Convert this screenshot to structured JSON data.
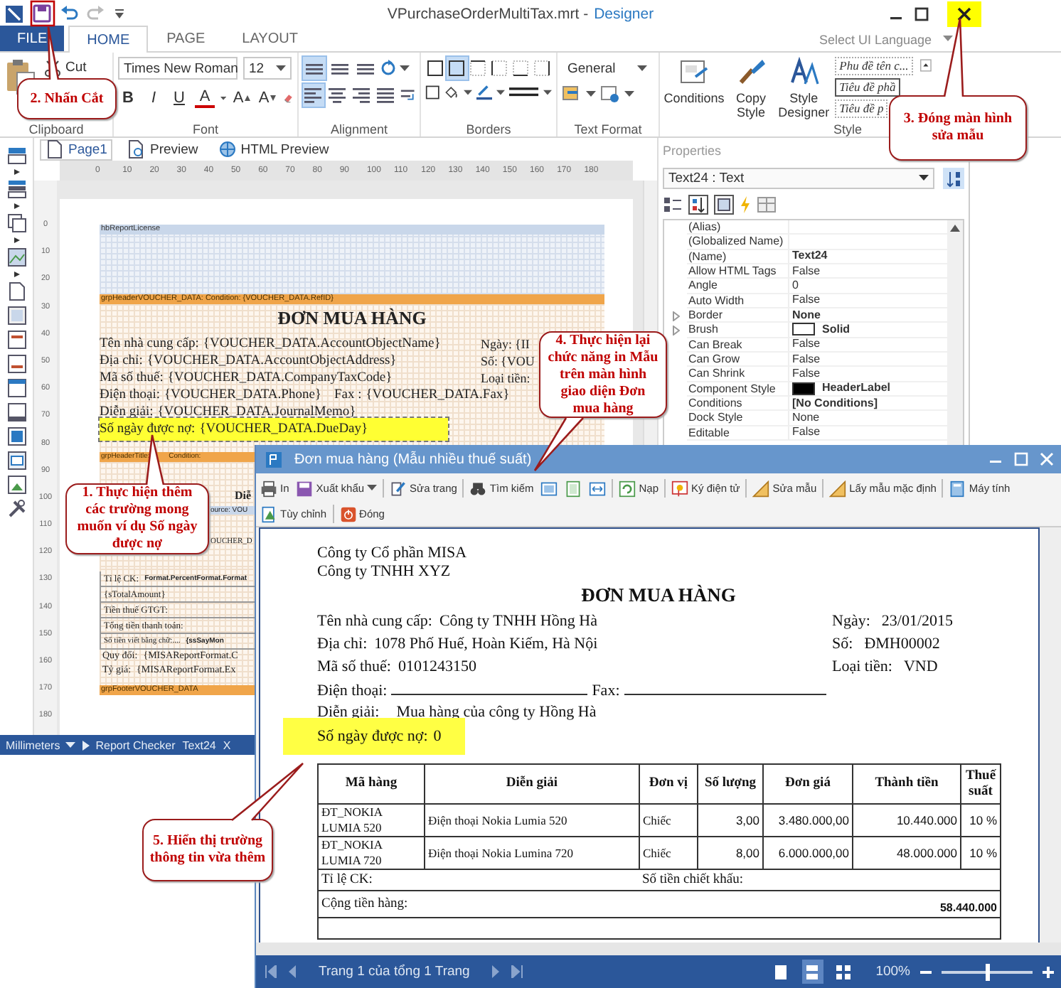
{
  "designer": {
    "title": "VPurchaseOrderMultiTax.mrt -",
    "app_name": "Designer",
    "close_button": {
      "highlighted": true
    },
    "ribbon_tabs": [
      {
        "label": "FILE",
        "kind": "file",
        "selected": false
      },
      {
        "label": "HOME",
        "kind": "tab",
        "selected": true
      },
      {
        "label": "PAGE",
        "kind": "tab",
        "selected": false
      },
      {
        "label": "LAYOUT",
        "kind": "tab",
        "selected": false
      }
    ],
    "ui_language": "Select UI Language",
    "ribbon": {
      "cut": "Cut",
      "font_name": "Times New Roman",
      "font_size": "12",
      "font_buttons": [
        {
          "label": "B",
          "kind": "bold"
        },
        {
          "label": "I",
          "kind": "italic"
        },
        {
          "label": "U",
          "kind": "underline"
        },
        {
          "label": "A",
          "kind": "color"
        },
        {
          "label": "A",
          "kind": "grow"
        },
        {
          "label": "A",
          "kind": "shrink"
        }
      ],
      "alignment": [
        {
          "selected": true
        },
        {
          "selected": false
        },
        {
          "selected": false
        },
        {
          "selected": true
        },
        {
          "selected": false
        },
        {
          "selected": false
        },
        {
          "selected": false
        }
      ],
      "borders": [
        {
          "selected": false
        },
        {
          "selected": true
        },
        {
          "selected": false
        },
        {
          "selected": false
        },
        {
          "selected": false
        },
        {
          "selected": false
        }
      ],
      "text_format": "General",
      "style_buttons": [
        "Conditions",
        "Copy Style",
        "Style Designer"
      ],
      "styles": [
        {
          "label": "Phu đề tên c...",
          "selected": false
        },
        {
          "label": "Tiêu đề phầ",
          "selected": true
        },
        {
          "label": "Tiêu đề p",
          "selected": false
        }
      ],
      "groups": [
        "Clipboard",
        "Font",
        "Alignment",
        "Borders",
        "Text Format",
        "Style"
      ]
    },
    "page_tabs": [
      {
        "label": "Page1",
        "selected": true
      },
      {
        "label": "Preview",
        "selected": false
      },
      {
        "label": "HTML Preview",
        "selected": false
      }
    ],
    "h_ruler": [
      "0",
      "10",
      "20",
      "30",
      "40",
      "50",
      "60",
      "70",
      "80",
      "90",
      "100",
      "110",
      "120",
      "130",
      "140",
      "150",
      "160",
      "170",
      "180"
    ],
    "v_ruler": [
      "0",
      "10",
      "20",
      "30",
      "40",
      "50",
      "60",
      "70",
      "80",
      "90",
      "100",
      "110",
      "120",
      "130",
      "140",
      "150",
      "160",
      "170",
      "180"
    ],
    "report": {
      "license_band": "hbReportLicense",
      "group_header": "grpHeaderVOUCHER_DATA: Condition: {VOUCHER_DATA.RefID}",
      "title": "ĐƠN MUA HÀNG",
      "fields": [
        {
          "label": "Tên nhà cung cấp:",
          "value": "{VOUCHER_DATA.AccountObjectName}",
          "selected": false
        },
        {
          "label": "Địa chỉ:",
          "value": "{VOUCHER_DATA.AccountObjectAddress}",
          "selected": false
        },
        {
          "label": "Mã số thuế:",
          "value": "{VOUCHER_DATA.CompanyTaxCode}",
          "selected": false
        },
        {
          "label": "Điện thoại:",
          "value": "{VOUCHER_DATA.Phone}",
          "extra_label": "Fax :",
          "extra_value": "{VOUCHER_DATA.Fax}",
          "selected": false
        },
        {
          "label": "Diễn giải:",
          "value": "{VOUCHER_DATA.JournalMemo}",
          "selected": false
        },
        {
          "label": "Số ngày được nợ:",
          "value": "{VOUCHER_DATA.DueDay}",
          "selected": true
        }
      ],
      "right_fields": [
        {
          "label": "Ngày:",
          "value": "{II"
        },
        {
          "label": "Số:",
          "value": "{VOU"
        },
        {
          "label": "Loại tiền:"
        }
      ],
      "title_header": "grpHeaderTitle: Condition:",
      "title_fragment": "Diễ",
      "data_band": "ource: VOU",
      "data_fragment": "OUCHER_D",
      "footer_lines": [
        {
          "label": "Tỉ lệ CK:",
          "value": "Format.PercentFormat.Format"
        },
        {
          "label": "{sTotalAmount}"
        },
        {
          "label": "Tiền thuế GTGT:"
        },
        {
          "label": "Tổng tiền thanh toán:"
        },
        {
          "label": "Số tiền viết bằng chữ:....",
          "value": "{ssSayMon"
        },
        {
          "label": "Quy đổi:",
          "value": "{MISAReportFormat.C"
        },
        {
          "label": "Tỷ giá:",
          "value": "{MISAReportFormat.Ex"
        }
      ],
      "group_footer": "grpFooterVOUCHER_DATA"
    },
    "properties": {
      "title": "Properties",
      "object": "Text24 : Text",
      "rows": [
        {
          "name": "(Alias)",
          "expandable": false
        },
        {
          "name": "(Globalized Name)",
          "expandable": false
        },
        {
          "name": "(Name)",
          "value": "Text24",
          "modified": true,
          "expandable": false
        },
        {
          "name": "Allow HTML Tags",
          "value": "False",
          "modified": false,
          "expandable": false
        },
        {
          "name": "Angle",
          "value": "0",
          "modified": false,
          "expandable": false
        },
        {
          "name": "Auto Width",
          "value": "False",
          "modified": false,
          "expandable": false
        },
        {
          "name": "Border",
          "value": "None",
          "modified": true,
          "expandable": true
        },
        {
          "name": "Brush",
          "value": "Solid",
          "modified": true,
          "expandable": true,
          "color": "#ffffff"
        },
        {
          "name": "Can Break",
          "value": "False",
          "modified": false,
          "expandable": false
        },
        {
          "name": "Can Grow",
          "value": "False",
          "modified": false,
          "expandable": false
        },
        {
          "name": "Can Shrink",
          "value": "False",
          "modified": false,
          "expandable": false
        },
        {
          "name": "Component Style",
          "value": "HeaderLabel",
          "modified": true,
          "expandable": false,
          "color": "#000000"
        },
        {
          "name": "Conditions",
          "value": "[No Conditions]",
          "modified": true,
          "expandable": false
        },
        {
          "name": "Dock Style",
          "value": "None",
          "modified": false,
          "expandable": false
        },
        {
          "name": "Editable",
          "value": "False",
          "modified": false,
          "expandable": false
        }
      ]
    },
    "status_bar": [
      "Millimeters",
      "Report Checker",
      "Text24",
      "X"
    ]
  },
  "preview": {
    "title": "Đơn mua hàng (Mẫu nhiều thuế suất)",
    "toolbar": [
      [
        [
          {
            "kind": "button",
            "label": "In"
          },
          {
            "kind": "dropdown",
            "label": "Xuất khẩu"
          }
        ],
        [
          {
            "kind": "button",
            "label": "Sửa trang"
          }
        ],
        [
          {
            "kind": "button",
            "label": "Tìm kiếm"
          },
          {
            "kind": "icon"
          },
          {
            "kind": "icon"
          },
          {
            "kind": "icon"
          }
        ],
        [
          {
            "kind": "button",
            "label": "Nạp"
          }
        ],
        [
          {
            "kind": "button",
            "label": "Ký điện tử"
          }
        ],
        [
          {
            "kind": "button",
            "label": "Sửa mẫu"
          }
        ],
        [
          {
            "kind": "button",
            "label": "Lấy mẫu mặc định"
          }
        ],
        [
          {
            "kind": "button",
            "label": "Máy tính"
          }
        ]
      ],
      [
        [
          {
            "kind": "button",
            "label": "Tùy chỉnh"
          }
        ],
        [
          {
            "kind": "button",
            "label": "Đóng"
          }
        ]
      ]
    ],
    "document": {
      "companies": [
        "Công ty Cổ phần MISA",
        "Công ty TNHH XYZ"
      ],
      "title": "ĐƠN MUA HÀNG",
      "rows": [
        {
          "label": "Tên nhà cung cấp:",
          "value": "Công ty TNHH Hồng Hà",
          "right_label": "Ngày:",
          "right_value": "23/01/2015"
        },
        {
          "label": "Địa chỉ:",
          "value": "1078 Phố Huế, Hoàn Kiếm, Hà Nội",
          "right_label": "Số:",
          "right_value": "ĐMH00002"
        },
        {
          "label": "Mã số thuế:",
          "value": "0101243150",
          "right_label": "Loại tiền:",
          "right_value": "VND"
        }
      ],
      "phone_label": "Điện thoại:",
      "fax_label": "Fax:",
      "memo_label": "Diễn giải:",
      "memo_value": "Mua hàng của công ty Hồng Hà",
      "due_day": {
        "label": "Số ngày được nợ:",
        "value": "0",
        "highlighted": true
      },
      "table": {
        "columns": [
          "Mã hàng",
          "Diễn giải",
          "Đơn vị",
          "Số lượng",
          "Đơn giá",
          "Thành tiền",
          "Thuế suất"
        ],
        "rows": [
          [
            "ĐT_NOKIA LUMIA 520",
            "Điện thoại Nokia Lumia 520",
            "Chiếc",
            "3,00",
            "3.480.000,00",
            "10.440.000",
            "10 %"
          ],
          [
            "ĐT_NOKIA LUMIA 720",
            "Điện thoại Nokia Lumina 720",
            "Chiếc",
            "8,00",
            "6.000.000,00",
            "48.000.000",
            "10 %"
          ]
        ],
        "discount_label": "Tỉ lệ CK:",
        "discount_amount_label": "Số tiền chiết khấu:",
        "subtotal_label": "Cộng tiền hàng:",
        "subtotal": "58.440.000"
      }
    },
    "footer": {
      "page": "Trang 1 của tổng 1 Trang",
      "view_modes": [
        {
          "selected": false
        },
        {
          "selected": true
        },
        {
          "selected": false
        }
      ],
      "zoom": {
        "reading": "100%",
        "level": 0.5
      }
    }
  },
  "callouts": [
    {
      "text": "1. Thực hiện thêm các trường mong muốn ví dụ Số ngày được nợ"
    },
    {
      "text": "2. Nhấn Cắt"
    },
    {
      "text": "3. Đóng màn hình sửa mẫu"
    },
    {
      "text": "4. Thực hiện lại chức năng in Mẫu trên màn hình giao diện Đơn mua hàng"
    },
    {
      "text": "5. Hiển thị trường thông tin vừa thêm"
    }
  ]
}
